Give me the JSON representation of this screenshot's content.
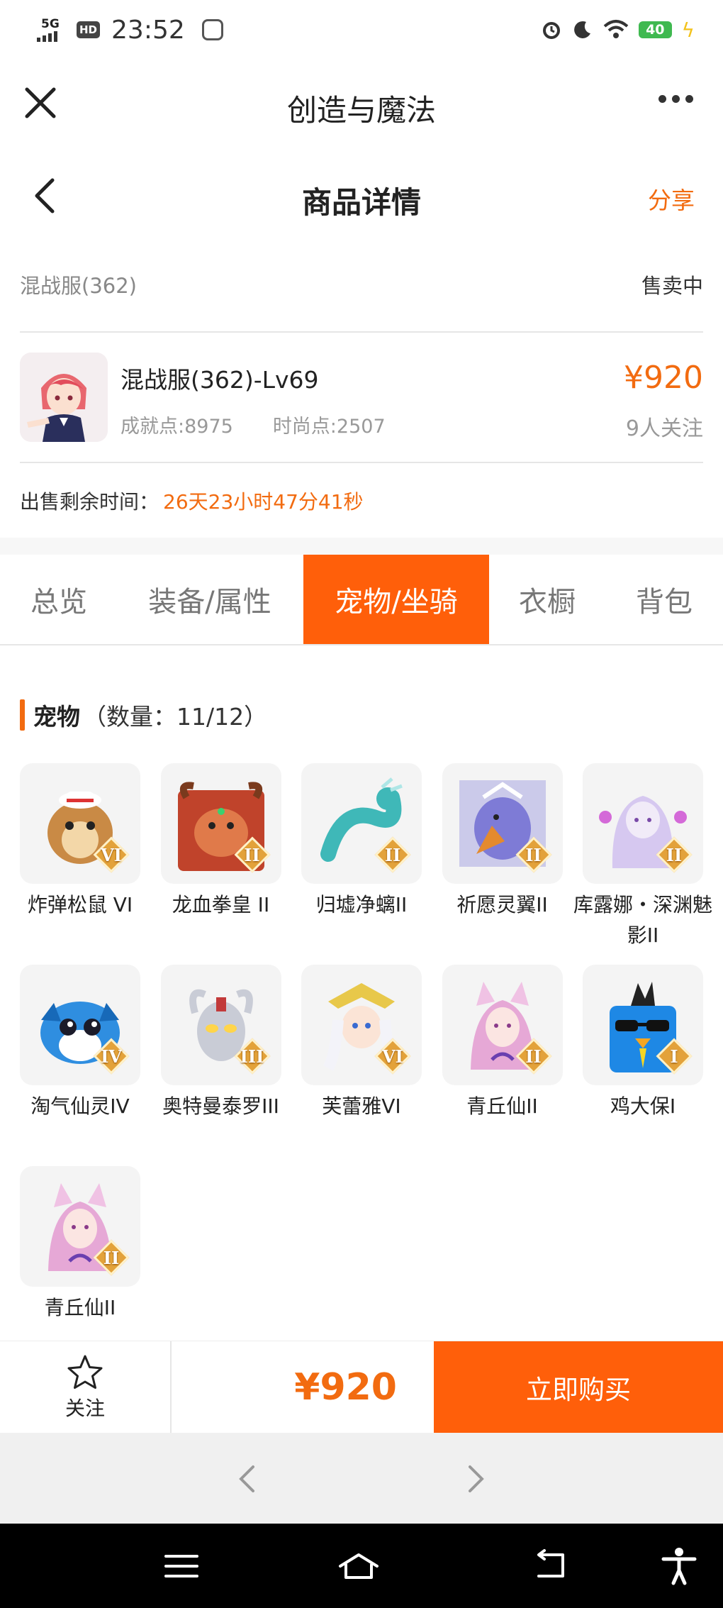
{
  "status_bar": {
    "network": "5G",
    "hd": "HD",
    "time": "23:52",
    "battery": "40"
  },
  "title_bar": {
    "app_title": "创造与魔法"
  },
  "nav_header": {
    "title": "商品详情",
    "share_label": "分享"
  },
  "product": {
    "server": "混战服(362)",
    "status": "售卖中",
    "title": "混战服(362)-Lv69",
    "achievement": "成就点:8975",
    "fashion": "时尚点:2507",
    "price": "¥920",
    "followers": "9人关注",
    "remaining_label": "出售剩余时间：",
    "remaining_value": "26天23小时47分41秒"
  },
  "tabs": [
    {
      "label": "总览",
      "active": false
    },
    {
      "label": "装备/属性",
      "active": false
    },
    {
      "label": "宠物/坐骑",
      "active": true
    },
    {
      "label": "衣橱",
      "active": false
    },
    {
      "label": "背包",
      "active": false
    }
  ],
  "pets_section": {
    "title": "宠物",
    "count": "（数量：11/12）",
    "items": [
      {
        "name": "炸弹松鼠 VI",
        "grade": "VI",
        "icon": "squirrel-icon",
        "color": "#c98a45"
      },
      {
        "name": "龙血拳皇 II",
        "grade": "II",
        "icon": "bull-warrior-icon",
        "color": "#c0432b"
      },
      {
        "name": "归墟净螭II",
        "grade": "II",
        "icon": "water-dragon-icon",
        "color": "#3fb8b8"
      },
      {
        "name": "祈愿灵翼II",
        "grade": "II",
        "icon": "griffin-icon",
        "color": "#7e7bd6"
      },
      {
        "name": "库露娜・深渊魅影II",
        "grade": "II",
        "icon": "ghost-girl-icon",
        "color": "#d6c8f0"
      },
      {
        "name": "淘气仙灵IV",
        "grade": "IV",
        "icon": "blue-dog-icon",
        "color": "#2f8ee0"
      },
      {
        "name": "奥特曼泰罗III",
        "grade": "III",
        "icon": "ultraman-icon",
        "color": "#c9ccd6"
      },
      {
        "name": "芙蕾雅VI",
        "grade": "VI",
        "icon": "valkyrie-icon",
        "color": "#e8c84a"
      },
      {
        "name": "青丘仙II",
        "grade": "II",
        "icon": "fox-fairy-icon",
        "color": "#e6a8d6"
      },
      {
        "name": "鸡大保I",
        "grade": "I",
        "icon": "blue-chicken-icon",
        "color": "#1e88e5"
      },
      {
        "name": "青丘仙II",
        "grade": "II",
        "icon": "fox-fairy-icon",
        "color": "#e6a8d6"
      }
    ]
  },
  "buy_bar": {
    "follow_label": "关注",
    "price": "¥920",
    "buy_label": "立即购买"
  },
  "colors": {
    "accent": "#ff5f0a",
    "price": "#f26b10"
  }
}
